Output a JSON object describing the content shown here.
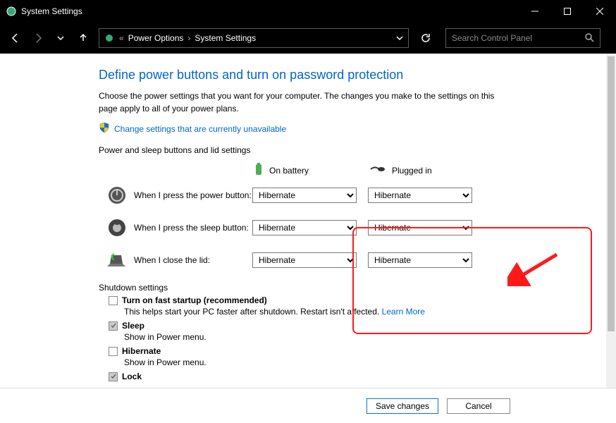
{
  "window": {
    "title": "System Settings"
  },
  "nav": {
    "breadcrumb": [
      "Power Options",
      "System Settings"
    ],
    "search_placeholder": "Search Control Panel"
  },
  "page": {
    "heading": "Define power buttons and turn on password protection",
    "description": "Choose the power settings that you want for your computer. The changes you make to the settings on this page apply to all of your power plans.",
    "admin_link": "Change settings that are currently unavailable",
    "section1": "Power and sleep buttons and lid settings",
    "cols": {
      "battery": "On battery",
      "plugged": "Plugged in"
    },
    "rows": [
      {
        "label": "When I press the power button:",
        "battery": "Hibernate",
        "plugged": "Hibernate"
      },
      {
        "label": "When I press the sleep button:",
        "battery": "Hibernate",
        "plugged": "Hibernate"
      },
      {
        "label": "When I close the lid:",
        "battery": "Hibernate",
        "plugged": "Hibernate"
      }
    ],
    "section2": "Shutdown settings",
    "shutdown": [
      {
        "checked": false,
        "title": "Turn on fast startup (recommended)",
        "sub": "This helps start your PC faster after shutdown. Restart isn't affected.",
        "link": "Learn More"
      },
      {
        "checked": true,
        "title": "Sleep",
        "sub": "Show in Power menu."
      },
      {
        "checked": false,
        "title": "Hibernate",
        "sub": "Show in Power menu."
      },
      {
        "checked": true,
        "title": "Lock",
        "sub": ""
      }
    ]
  },
  "buttons": {
    "save": "Save changes",
    "cancel": "Cancel"
  }
}
